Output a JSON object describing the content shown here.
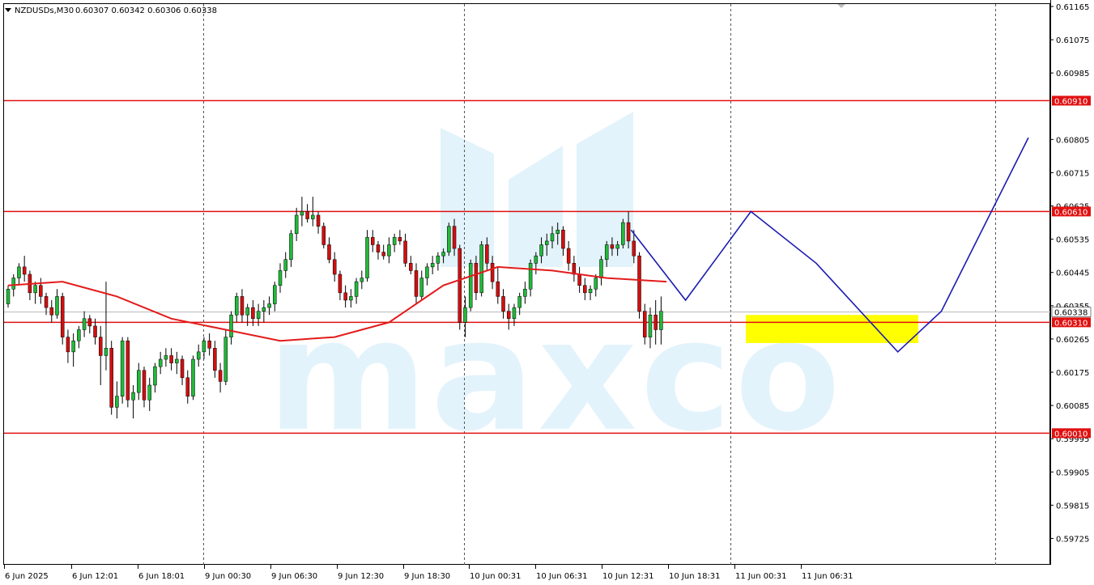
{
  "header": {
    "symbol_label": "NZDUSDs,M30",
    "ohlc_label": "0.60307 0.60342 0.60306 0.60338",
    "menu_icon": "triangle-down-icon"
  },
  "watermark": {
    "text": "maxco",
    "color": "#e3f3fb"
  },
  "colors": {
    "bull": "#22b83a",
    "bear": "#d10f0f",
    "ma": "#e31b1b",
    "level": "#e01010",
    "pattern": "#1b1bb0",
    "zone": "#ffff00",
    "grid": "#555555",
    "current_line": "#b8b8b8"
  },
  "chart_data": {
    "type": "candlestick",
    "symbol": "NZDUSDs",
    "timeframe": "M30",
    "ylim": [
      0.5968,
      0.61165
    ],
    "y_ticks": [
      0.61165,
      0.61075,
      0.60985,
      0.60805,
      0.60715,
      0.60625,
      0.60535,
      0.60445,
      0.60355,
      0.60265,
      0.60175,
      0.60085,
      0.59995,
      0.59905,
      0.59815,
      0.59725
    ],
    "x_labels": [
      "6 Jun 2025",
      "6 Jun 12:01",
      "6 Jun 18:01",
      "9 Jun 00:30",
      "9 Jun 06:30",
      "9 Jun 12:30",
      "9 Jun 18:30",
      "10 Jun 00:31",
      "10 Jun 06:31",
      "10 Jun 12:31",
      "10 Jun 18:31",
      "11 Jun 00:31",
      "11 Jun 06:31"
    ],
    "day_separators": [
      "9 Jun 2025",
      "10 Jun 2025",
      "11 Jun 2025",
      "12 Jun 2025"
    ],
    "bar_count": 122,
    "horizontal_levels": [
      {
        "label": "0.60910",
        "value": 0.6091
      },
      {
        "label": "0.60610",
        "value": 0.6061
      },
      {
        "label": "0.60310",
        "value": 0.6031
      },
      {
        "label": "0.60010",
        "value": 0.6001
      }
    ],
    "current_price": {
      "label": "0.60338",
      "value": 0.60338
    },
    "support_zone": {
      "top": 0.6033,
      "bottom": 0.60254
    },
    "moving_average": [
      [
        0,
        0.6041
      ],
      [
        10,
        0.6042
      ],
      [
        20,
        0.6038
      ],
      [
        30,
        0.6032
      ],
      [
        40,
        0.6029
      ],
      [
        50,
        0.6026
      ],
      [
        60,
        0.6027
      ],
      [
        70,
        0.6031
      ],
      [
        80,
        0.6041
      ],
      [
        90,
        0.6046
      ],
      [
        100,
        0.6045
      ],
      [
        110,
        0.6043
      ],
      [
        121,
        0.6042
      ]
    ],
    "pattern_path": [
      [
        114.5,
        0.6056
      ],
      [
        124.5,
        0.6037
      ],
      [
        136.5,
        0.6061
      ],
      [
        148.5,
        0.6047
      ],
      [
        163.5,
        0.6023
      ],
      [
        171.5,
        0.6034
      ],
      [
        187.5,
        0.6081
      ]
    ],
    "candles": [
      [
        0.6036,
        0.6041,
        0.6035,
        0.604
      ],
      [
        0.604,
        0.6044,
        0.6038,
        0.6043
      ],
      [
        0.6043,
        0.6047,
        0.6041,
        0.6046
      ],
      [
        0.6046,
        0.6049,
        0.6042,
        0.6044
      ],
      [
        0.6044,
        0.6045,
        0.6037,
        0.6039
      ],
      [
        0.6039,
        0.6042,
        0.6036,
        0.6041
      ],
      [
        0.6041,
        0.6043,
        0.6036,
        0.6038
      ],
      [
        0.6038,
        0.6039,
        0.6033,
        0.6035
      ],
      [
        0.6035,
        0.6037,
        0.6031,
        0.6033
      ],
      [
        0.6033,
        0.604,
        0.6032,
        0.6038
      ],
      [
        0.6038,
        0.6039,
        0.6025,
        0.6027
      ],
      [
        0.6027,
        0.6029,
        0.602,
        0.6023
      ],
      [
        0.6023,
        0.6028,
        0.6019,
        0.6026
      ],
      [
        0.6026,
        0.603,
        0.6024,
        0.6029
      ],
      [
        0.6029,
        0.6034,
        0.6027,
        0.6032
      ],
      [
        0.6032,
        0.6033,
        0.6028,
        0.603
      ],
      [
        0.603,
        0.6032,
        0.6025,
        0.6027
      ],
      [
        0.6027,
        0.603,
        0.6014,
        0.6022
      ],
      [
        0.6022,
        0.6042,
        0.6018,
        0.6024
      ],
      [
        0.6024,
        0.6026,
        0.6006,
        0.6008
      ],
      [
        0.6008,
        0.6015,
        0.6005,
        0.6011
      ],
      [
        0.6011,
        0.6027,
        0.6009,
        0.6026
      ],
      [
        0.6026,
        0.6027,
        0.6008,
        0.601
      ],
      [
        0.601,
        0.6014,
        0.6005,
        0.6012
      ],
      [
        0.6012,
        0.602,
        0.601,
        0.6018
      ],
      [
        0.6018,
        0.6019,
        0.6008,
        0.601
      ],
      [
        0.601,
        0.6016,
        0.6007,
        0.6014
      ],
      [
        0.6014,
        0.602,
        0.6012,
        0.6019
      ],
      [
        0.6019,
        0.6023,
        0.6017,
        0.6021
      ],
      [
        0.6021,
        0.6024,
        0.6019,
        0.6022
      ],
      [
        0.6022,
        0.6024,
        0.6018,
        0.602
      ],
      [
        0.602,
        0.6023,
        0.6017,
        0.6021
      ],
      [
        0.6021,
        0.6022,
        0.6014,
        0.6016
      ],
      [
        0.6016,
        0.6018,
        0.6009,
        0.6011
      ],
      [
        0.6011,
        0.6022,
        0.601,
        0.6021
      ],
      [
        0.6021,
        0.6025,
        0.6019,
        0.6023
      ],
      [
        0.6023,
        0.6027,
        0.6021,
        0.6026
      ],
      [
        0.6026,
        0.6028,
        0.6022,
        0.6024
      ],
      [
        0.6024,
        0.6026,
        0.6016,
        0.6018
      ],
      [
        0.6018,
        0.602,
        0.6012,
        0.6015
      ],
      [
        0.6015,
        0.6029,
        0.6014,
        0.6027
      ],
      [
        0.6027,
        0.6034,
        0.6025,
        0.6033
      ],
      [
        0.6033,
        0.6039,
        0.6031,
        0.6038
      ],
      [
        0.6038,
        0.604,
        0.6031,
        0.6033
      ],
      [
        0.6033,
        0.6036,
        0.603,
        0.6035
      ],
      [
        0.6035,
        0.6037,
        0.603,
        0.6032
      ],
      [
        0.6032,
        0.6036,
        0.603,
        0.6034
      ],
      [
        0.6034,
        0.6037,
        0.6031,
        0.6035
      ],
      [
        0.6035,
        0.6038,
        0.6033,
        0.6036
      ],
      [
        0.6036,
        0.6042,
        0.6034,
        0.6041
      ],
      [
        0.6041,
        0.6047,
        0.6039,
        0.6045
      ],
      [
        0.6045,
        0.605,
        0.6043,
        0.6048
      ],
      [
        0.6048,
        0.6056,
        0.6046,
        0.6055
      ],
      [
        0.6055,
        0.6062,
        0.6053,
        0.606
      ],
      [
        0.606,
        0.6065,
        0.6057,
        0.6061
      ],
      [
        0.6061,
        0.6063,
        0.6058,
        0.6059
      ],
      [
        0.6059,
        0.6065,
        0.6057,
        0.606
      ],
      [
        0.606,
        0.6061,
        0.6055,
        0.6057
      ],
      [
        0.6057,
        0.6058,
        0.6051,
        0.6052
      ],
      [
        0.6052,
        0.6054,
        0.6047,
        0.6048
      ],
      [
        0.6048,
        0.605,
        0.6042,
        0.6044
      ],
      [
        0.6044,
        0.6045,
        0.6037,
        0.6039
      ],
      [
        0.6039,
        0.6041,
        0.6035,
        0.6037
      ],
      [
        0.6037,
        0.604,
        0.6035,
        0.6038
      ],
      [
        0.6038,
        0.6043,
        0.6036,
        0.6042
      ],
      [
        0.6042,
        0.6045,
        0.604,
        0.6043
      ],
      [
        0.6043,
        0.6056,
        0.6042,
        0.6054
      ],
      [
        0.6054,
        0.6056,
        0.605,
        0.6052
      ],
      [
        0.6052,
        0.6053,
        0.6048,
        0.605
      ],
      [
        0.605,
        0.6052,
        0.6048,
        0.6049
      ],
      [
        0.6049,
        0.6054,
        0.6047,
        0.6052
      ],
      [
        0.6052,
        0.6055,
        0.605,
        0.6054
      ],
      [
        0.6054,
        0.6056,
        0.6052,
        0.6053
      ],
      [
        0.6053,
        0.6055,
        0.6046,
        0.6047
      ],
      [
        0.6047,
        0.6049,
        0.6044,
        0.6045
      ],
      [
        0.6045,
        0.6047,
        0.6036,
        0.6038
      ],
      [
        0.6038,
        0.6045,
        0.6037,
        0.6043
      ],
      [
        0.6043,
        0.6047,
        0.6041,
        0.6046
      ],
      [
        0.6046,
        0.6049,
        0.6044,
        0.6047
      ],
      [
        0.6047,
        0.605,
        0.6045,
        0.6049
      ],
      [
        0.6049,
        0.6051,
        0.6047,
        0.605
      ],
      [
        0.605,
        0.6058,
        0.6049,
        0.6057
      ],
      [
        0.6057,
        0.6059,
        0.6049,
        0.6051
      ],
      [
        0.6051,
        0.6052,
        0.6029,
        0.6031
      ],
      [
        0.6031,
        0.6038,
        0.6027,
        0.6035
      ],
      [
        0.6035,
        0.6048,
        0.6034,
        0.6047
      ],
      [
        0.6047,
        0.6049,
        0.6037,
        0.6039
      ],
      [
        0.6039,
        0.6053,
        0.6038,
        0.6052
      ],
      [
        0.6052,
        0.6054,
        0.6045,
        0.6047
      ],
      [
        0.6047,
        0.6049,
        0.604,
        0.6042
      ],
      [
        0.6042,
        0.6046,
        0.6036,
        0.6038
      ],
      [
        0.6038,
        0.604,
        0.6032,
        0.6034
      ],
      [
        0.6034,
        0.6036,
        0.6029,
        0.6032
      ],
      [
        0.6032,
        0.6036,
        0.603,
        0.6035
      ],
      [
        0.6035,
        0.6039,
        0.6033,
        0.6038
      ],
      [
        0.6038,
        0.6042,
        0.6036,
        0.604
      ],
      [
        0.604,
        0.6048,
        0.6038,
        0.6047
      ],
      [
        0.6047,
        0.605,
        0.6044,
        0.6049
      ],
      [
        0.6049,
        0.6054,
        0.6047,
        0.6052
      ],
      [
        0.6052,
        0.6055,
        0.6049,
        0.6053
      ],
      [
        0.6053,
        0.6057,
        0.6051,
        0.6055
      ],
      [
        0.6055,
        0.6058,
        0.6052,
        0.6056
      ],
      [
        0.6056,
        0.6057,
        0.6049,
        0.6051
      ],
      [
        0.6051,
        0.6053,
        0.6045,
        0.6047
      ],
      [
        0.6047,
        0.6049,
        0.6042,
        0.6044
      ],
      [
        0.6044,
        0.6046,
        0.6039,
        0.6041
      ],
      [
        0.6041,
        0.6043,
        0.6037,
        0.6039
      ],
      [
        0.6039,
        0.6041,
        0.6037,
        0.604
      ],
      [
        0.604,
        0.6044,
        0.6038,
        0.6043
      ],
      [
        0.6043,
        0.6049,
        0.6041,
        0.6048
      ],
      [
        0.6048,
        0.6053,
        0.6046,
        0.6052
      ],
      [
        0.6052,
        0.6054,
        0.6049,
        0.6051
      ],
      [
        0.6051,
        0.6053,
        0.6049,
        0.6052
      ],
      [
        0.6052,
        0.6059,
        0.6051,
        0.6058
      ],
      [
        0.6058,
        0.6061,
        0.6051,
        0.6053
      ],
      [
        0.6053,
        0.6056,
        0.6047,
        0.6049
      ],
      [
        0.6049,
        0.605,
        0.6032,
        0.6034
      ],
      [
        0.6034,
        0.6036,
        0.6025,
        0.6027
      ],
      [
        0.6027,
        0.6035,
        0.6024,
        0.6033
      ],
      [
        0.6033,
        0.6037,
        0.6025,
        0.6029
      ],
      [
        0.6029,
        0.6038,
        0.6025,
        0.6034
      ]
    ]
  }
}
